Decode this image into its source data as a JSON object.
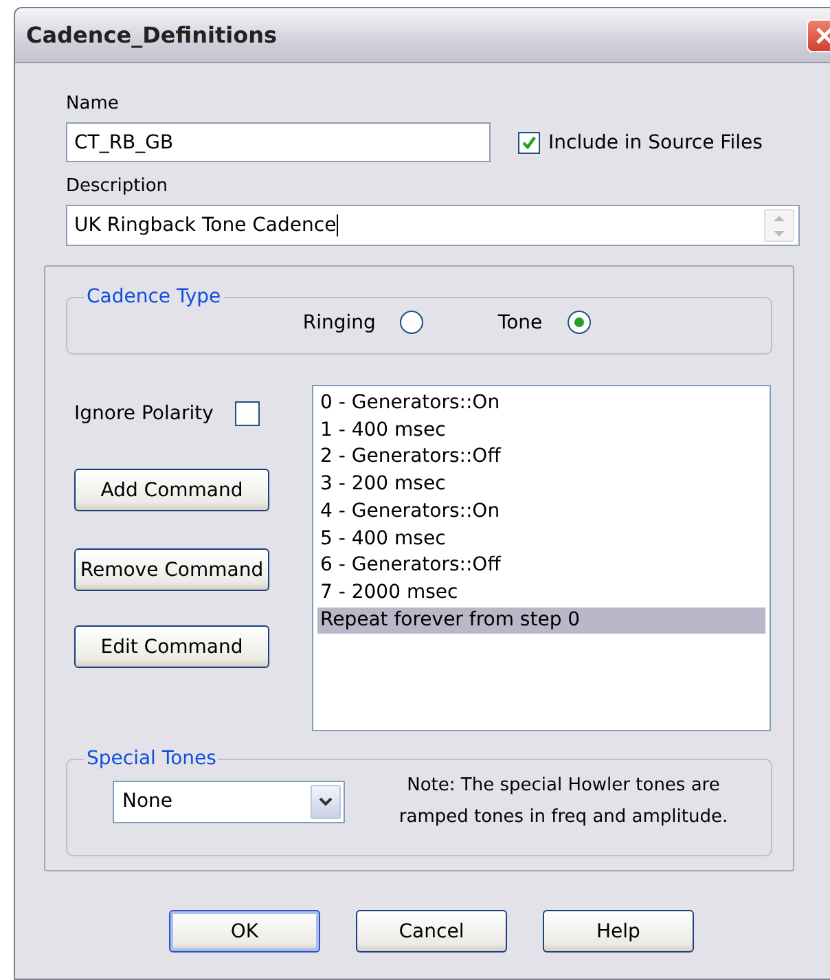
{
  "window": {
    "title": "Cadence_Definitions"
  },
  "name": {
    "label": "Name",
    "value": "CT_RB_GB"
  },
  "include_in_source": {
    "label": "Include in Source Files",
    "checked": true
  },
  "description": {
    "label": "Description",
    "value": "UK Ringback Tone Cadence"
  },
  "cadence_type": {
    "title": "Cadence Type",
    "options": [
      {
        "label": "Ringing",
        "selected": false
      },
      {
        "label": "Tone",
        "selected": true
      }
    ]
  },
  "ignore_polarity": {
    "label": "Ignore Polarity",
    "checked": false
  },
  "command_buttons": [
    "Add Command",
    "Remove Command",
    "Edit Command"
  ],
  "commands": [
    {
      "text": "0 - Generators::On",
      "selected": false
    },
    {
      "text": "1 - 400 msec",
      "selected": false
    },
    {
      "text": "2 - Generators::Off",
      "selected": false
    },
    {
      "text": "3 - 200 msec",
      "selected": false
    },
    {
      "text": "4 - Generators::On",
      "selected": false
    },
    {
      "text": "5 - 400 msec",
      "selected": false
    },
    {
      "text": "6 - Generators::Off",
      "selected": false
    },
    {
      "text": "7 - 2000 msec",
      "selected": false
    },
    {
      "text": "Repeat forever from step 0",
      "selected": true
    }
  ],
  "special_tones": {
    "title": "Special Tones",
    "value": "None",
    "note": "Note: The special Howler tones are ramped tones in freq and amplitude."
  },
  "buttons": [
    {
      "label": "OK",
      "default": true
    },
    {
      "label": "Cancel",
      "default": false
    },
    {
      "label": "Help",
      "default": false
    }
  ]
}
